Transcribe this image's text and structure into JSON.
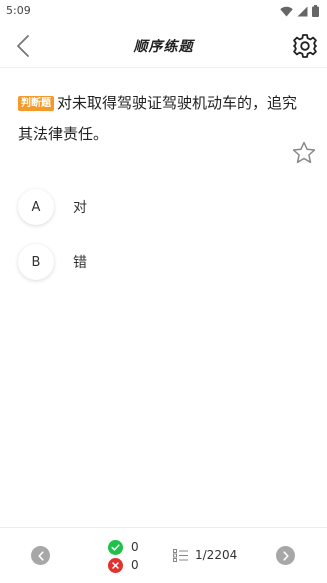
{
  "status_bar": {
    "time": "5:09"
  },
  "header": {
    "title": "顺序练题"
  },
  "question": {
    "type_badge": "判断题",
    "text": "对未取得驾驶证驾驶机动车的，追究其法律责任。"
  },
  "options": [
    {
      "letter": "A",
      "text": "对"
    },
    {
      "letter": "B",
      "text": "错"
    }
  ],
  "footer": {
    "correct_count": "0",
    "wrong_count": "0",
    "progress": "1/2204"
  },
  "colors": {
    "badge": "#f59a2a",
    "correct": "#1fc14a",
    "wrong": "#e0322e",
    "nav_button": "#a7a7a7"
  }
}
